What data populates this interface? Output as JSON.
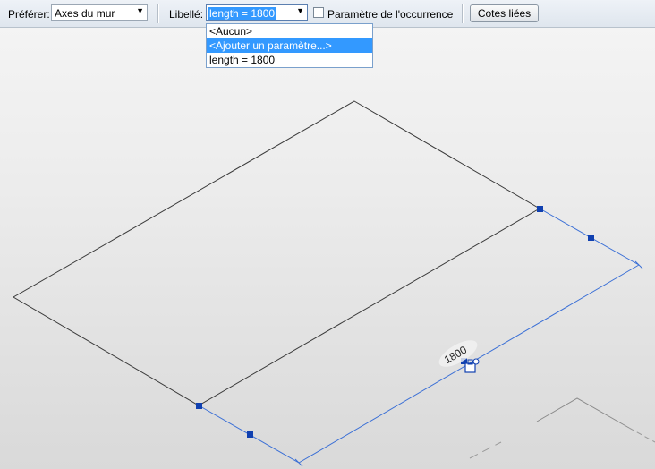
{
  "options_bar": {
    "prefer_label": "Préférer:",
    "prefer_value": "Axes du mur",
    "label_label": "Libellé:",
    "label_value": "length = 1800",
    "instance_param_label": "Paramètre de l'occurrence",
    "instance_param_checked": false,
    "linked_dims_button": "Cotes liées"
  },
  "dropdown": {
    "items": [
      "<Aucun>",
      "<Ajouter un paramètre...>",
      "length = 1800"
    ],
    "highlighted_index": 1
  },
  "canvas": {
    "dimension_text": "1800",
    "line_color": "#3a3a3a",
    "dimension_color": "#3a6fd6",
    "grip_color": "#1040b0"
  }
}
